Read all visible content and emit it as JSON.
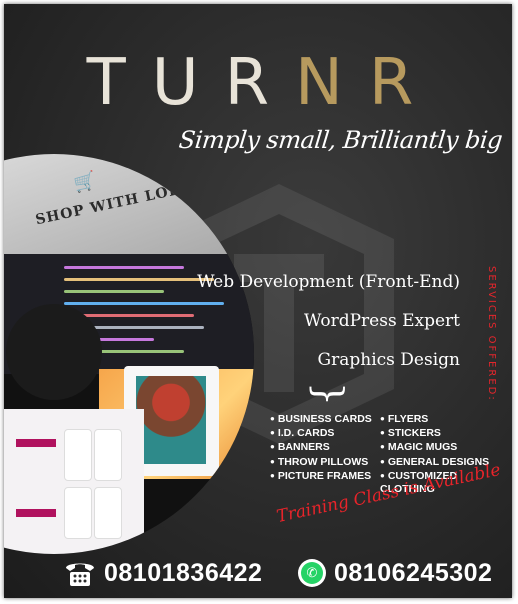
{
  "brand": {
    "name_letters": [
      "T",
      "U",
      "R",
      "N",
      "R"
    ],
    "tagline": "Simply small, Brilliantly big",
    "accent_light": "#e8e3d8",
    "accent_gold": "#b79a5e"
  },
  "collage": {
    "card_text": "SHOP WITH LOLA"
  },
  "services": {
    "vertical_label": "SERVICES OFFERED:",
    "items": [
      "Web Development (Front-End)",
      "WordPress Expert",
      "Graphics Design"
    ]
  },
  "design_list": {
    "left": [
      "BUSINESS CARDS",
      "I.D. CARDS",
      "BANNERS",
      "THROW PILLOWS",
      "PICTURE FRAMES"
    ],
    "right": [
      "FLYERS",
      "STICKERS",
      "MAGIC MUGS",
      "GENERAL DESIGNS",
      "CUSTOMIZED CLOTHING"
    ]
  },
  "training_note": "Training Class is Available",
  "contacts": {
    "phone": "08101836422",
    "whatsapp": "08106245302",
    "phone_icon": "telephone-icon",
    "whatsapp_icon": "whatsapp-icon",
    "whatsapp_color": "#25d366"
  },
  "colors": {
    "background": "#2a2a2a",
    "accent_red": "#e4262c"
  }
}
